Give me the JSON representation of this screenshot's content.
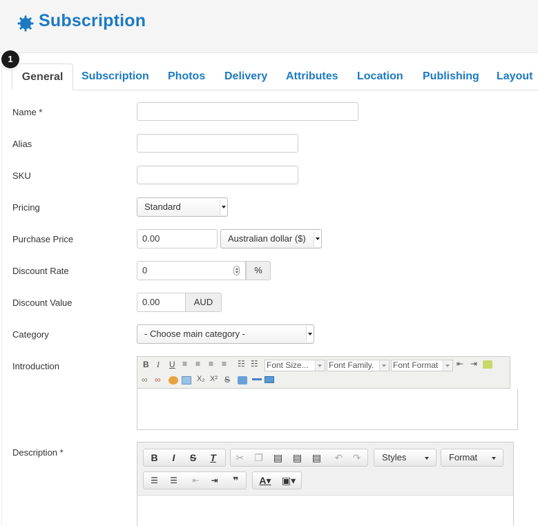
{
  "header": {
    "title": "Subscription",
    "icon": "gear-icon",
    "accent": "#1d7ac2"
  },
  "step_badge": "1",
  "tabs": [
    "General",
    "Subscription",
    "Photos",
    "Delivery",
    "Attributes",
    "Location",
    "Publishing",
    "Layout"
  ],
  "form": {
    "name_label": "Name *",
    "alias_label": "Alias",
    "sku_label": "SKU",
    "pricing_label": "Pricing",
    "pricing_value": "Standard",
    "purchase_price_label": "Purchase Price",
    "purchase_price_value": "0.00",
    "currency_value": "Australian dollar ($)",
    "discount_rate_label": "Discount Rate",
    "discount_rate_value": "0",
    "discount_rate_unit": "%",
    "discount_value_label": "Discount Value",
    "discount_value_value": "0.00",
    "discount_value_unit": "AUD",
    "category_label": "Category",
    "category_value": "- Choose main category -",
    "introduction_label": "Introduction",
    "description_label": "Description *"
  },
  "intro_editor": {
    "font_size": "Font Size...",
    "font_family": "Font Family.",
    "font_format": "Font Format"
  },
  "desc_editor": {
    "styles": "Styles",
    "format": "Format"
  }
}
